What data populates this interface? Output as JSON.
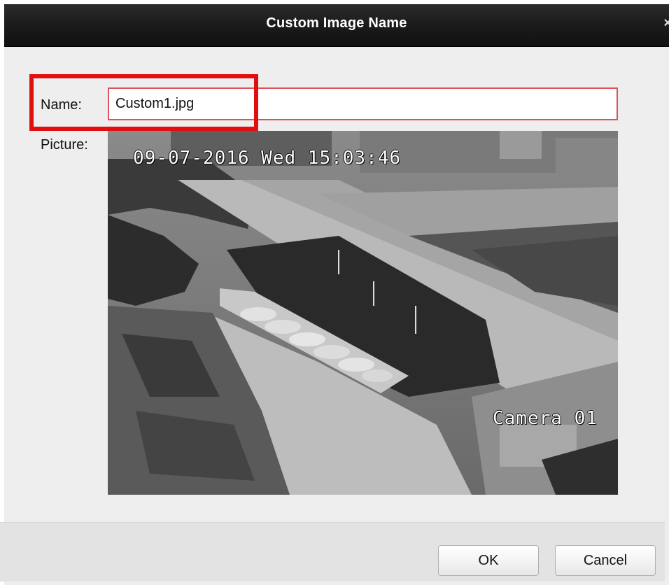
{
  "dialog": {
    "title": "Custom Image Name",
    "close_glyph": "×"
  },
  "form": {
    "name_label": "Name:",
    "name_value": "Custom1.jpg",
    "picture_label": "Picture:"
  },
  "preview": {
    "timestamp": "09-07-2016 Wed 15:03:46",
    "camera_name": "Camera 01"
  },
  "buttons": {
    "ok": "OK",
    "cancel": "Cancel"
  },
  "colors": {
    "titlebar": "#1c1c1c",
    "dialog_bg": "#eeeeee",
    "input_border": "#e0525b",
    "highlight": "#e01010"
  }
}
